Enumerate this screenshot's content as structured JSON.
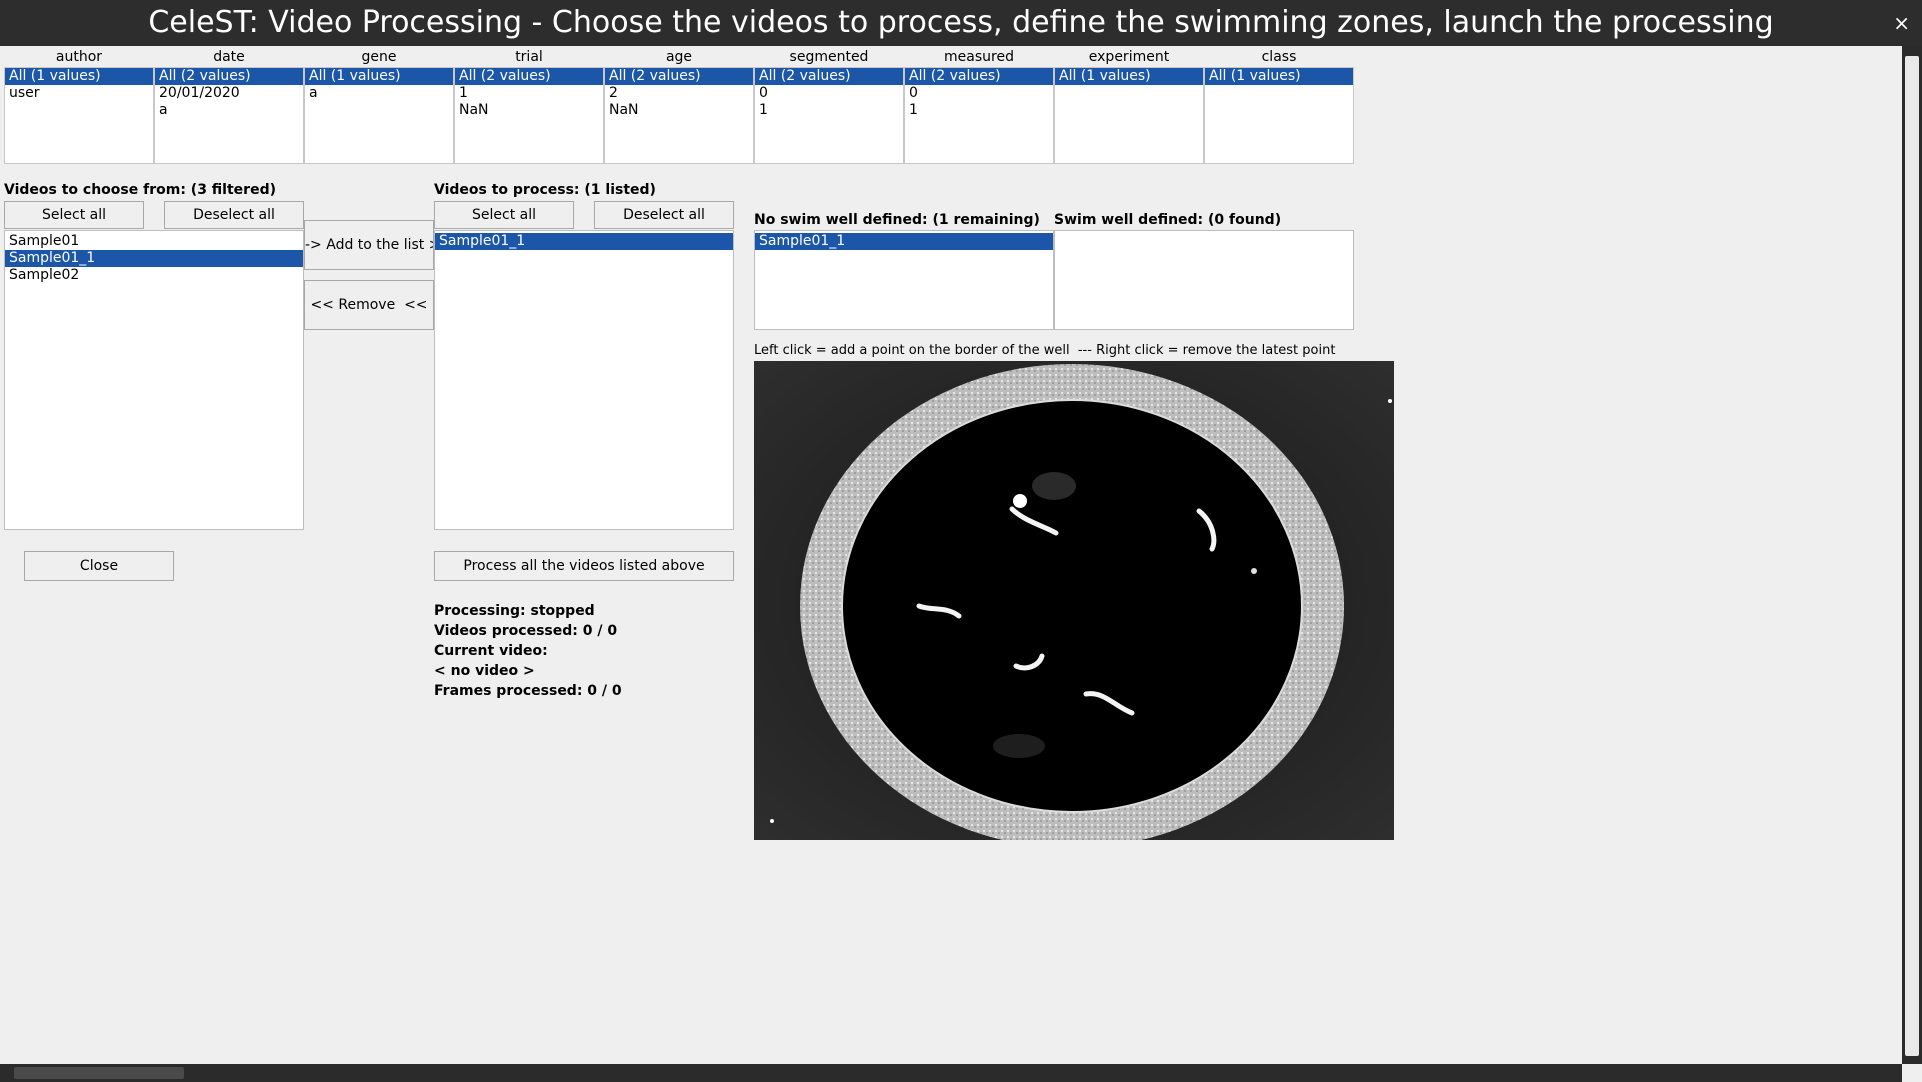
{
  "window": {
    "title": "CeleST: Video Processing - Choose the videos to process, define the swimming zones, launch the processing",
    "close_glyph": "×"
  },
  "filters": [
    {
      "header": "author",
      "items": [
        "All (1 values)",
        "user"
      ]
    },
    {
      "header": "date",
      "items": [
        "All (2 values)",
        "20/01/2020",
        "a"
      ]
    },
    {
      "header": "gene",
      "items": [
        "All (1 values)",
        "a"
      ]
    },
    {
      "header": "trial",
      "items": [
        "All (2 values)",
        "1",
        "NaN"
      ]
    },
    {
      "header": "age",
      "items": [
        "All (2 values)",
        "2",
        "NaN"
      ]
    },
    {
      "header": "segmented",
      "items": [
        "All (2 values)",
        "0",
        "1"
      ]
    },
    {
      "header": "measured",
      "items": [
        "All (2 values)",
        "0",
        "1"
      ]
    },
    {
      "header": "experiment",
      "items": [
        "All (1 values)"
      ]
    },
    {
      "header": "class",
      "items": [
        "All (1 values)"
      ]
    }
  ],
  "choose": {
    "label": "Videos to choose from: (3 filtered)",
    "select_all": "Select all",
    "deselect_all": "Deselect all",
    "items": [
      "Sample01",
      "Sample01_1",
      "Sample02"
    ],
    "selected": "Sample01_1"
  },
  "transfer": {
    "add": "-> Add to the list >>",
    "remove": "<< Remove  <<"
  },
  "process": {
    "label": "Videos to process: (1 listed)",
    "select_all": "Select all",
    "deselect_all": "Deselect all",
    "items": [
      "Sample01_1"
    ],
    "process_button": "Process all the videos listed above"
  },
  "close_button": "Close",
  "status": {
    "processing": "Processing: stopped",
    "videos_processed": "Videos processed: 0 / 0",
    "current_video": "Current video:",
    "current_video_value": "< no video >",
    "frames_processed": "Frames processed: 0 / 0"
  },
  "wells": {
    "no_swim_label": "No swim well defined: (1 remaining)",
    "no_swim_items": [
      "Sample01_1"
    ],
    "swim_label": "Swim well defined: (0 found)",
    "instruction": "Left click = add a point on the border of the well  --- Right click = remove the latest point"
  },
  "colors": {
    "selection": "#1b56a8",
    "titlebar": "#2d2d2d",
    "background": "#efefef"
  }
}
